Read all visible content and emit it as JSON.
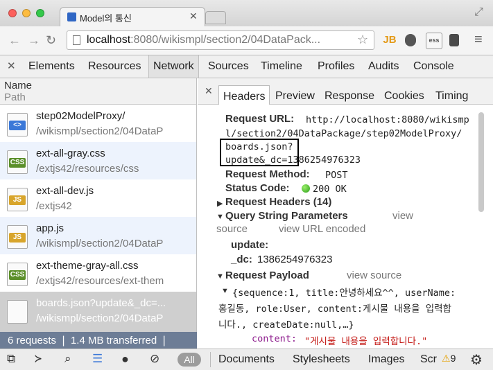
{
  "browser": {
    "tab_title": "Model의 통신",
    "tab_close": "✕",
    "url_host": "localhost",
    "url_rest": ":8080/wikismpl/section2/04DataPack...",
    "extensions": [
      "JB",
      "ess"
    ]
  },
  "devtools": {
    "close": "✕",
    "tabs": [
      "Elements",
      "Resources",
      "Network",
      "Sources",
      "Timeline",
      "Profiles",
      "Audits",
      "Console"
    ],
    "active_tab": "Network"
  },
  "network": {
    "col_name": "Name",
    "col_path": "Path",
    "rows": [
      {
        "name": "step02ModelProxy/",
        "path": "/wikismpl/section2/04DataP",
        "type": "html",
        "icon": "<>"
      },
      {
        "name": "ext-all-gray.css",
        "path": "/extjs42/resources/css",
        "type": "css",
        "icon": "CSS"
      },
      {
        "name": "ext-all-dev.js",
        "path": "/extjs42",
        "type": "js",
        "icon": "JS"
      },
      {
        "name": "app.js",
        "path": "/wikismpl/section2/04DataP",
        "type": "js",
        "icon": "JS"
      },
      {
        "name": "ext-theme-gray-all.css",
        "path": "/extjs42/resources/ext-them",
        "type": "css",
        "icon": "CSS"
      },
      {
        "name": "boards.json?update&_dc=...",
        "path": "/wikismpl/section2/04DataP",
        "type": "doc",
        "icon": ""
      }
    ],
    "summary": "6 requests  ❘  1.4 MB transferred  ❘"
  },
  "details": {
    "close": "✕",
    "tabs": [
      "Headers",
      "Preview",
      "Response",
      "Cookies",
      "Timing"
    ],
    "active_tab": "Headers",
    "request_url_label": "Request URL:",
    "request_url_l1": "http://localhost:8080/wikismp",
    "request_url_l2": "l/section2/04DataPackage/step02ModelProxy/",
    "request_url_l3": "boards.json?",
    "request_url_l4": "update&_dc=1386254976323",
    "request_method_label": "Request Method:",
    "request_method": "POST",
    "status_code_label": "Status Code:",
    "status_code": "200 OK",
    "request_headers": "Request Headers (14)",
    "query_string": "Query String Parameters",
    "view_source": "view source",
    "qs_view_source_1": "view",
    "qs_view_source_2": "source",
    "view_url_encoded": "view URL encoded",
    "param_update": "update:",
    "param_dc_label": "_dc:",
    "param_dc_value": "1386254976323",
    "request_payload": "Request Payload",
    "payload_l1": "{sequence:1, title:안녕하세요^^, userName:",
    "payload_l2": "홍길동, role:User, content:게시물 내용을 입력합",
    "payload_l3": "니다., createDate:null,…}",
    "content_key": "content:",
    "content_value": "\"게시물 내용을 입력합니다.\""
  },
  "bottom": {
    "all": "All",
    "filters": [
      "Documents",
      "Stylesheets",
      "Images",
      "Scr"
    ],
    "warnings": "9"
  }
}
